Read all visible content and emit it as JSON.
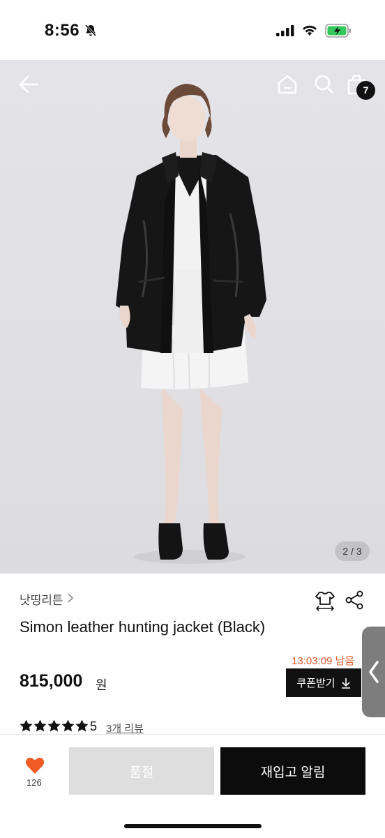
{
  "status_bar": {
    "time": "8:56"
  },
  "header": {
    "cart_count": "7"
  },
  "image": {
    "page_indicator": "2 / 3"
  },
  "product": {
    "brand": "낫띵리튼",
    "name": "Simon leather hunting jacket (Black)",
    "timer": "13:03:09 남음",
    "price": "815,000",
    "currency": "원",
    "coupon_label": "쿠폰받기",
    "rating": "5",
    "review_link": "3개 리뷰"
  },
  "bottom_bar": {
    "like_count": "126",
    "soldout_label": "품절",
    "restock_label": "재입고 알림"
  },
  "colors": {
    "accent": "#e05a2b",
    "heart": "#f15a24",
    "dark": "#0c0c0c"
  }
}
